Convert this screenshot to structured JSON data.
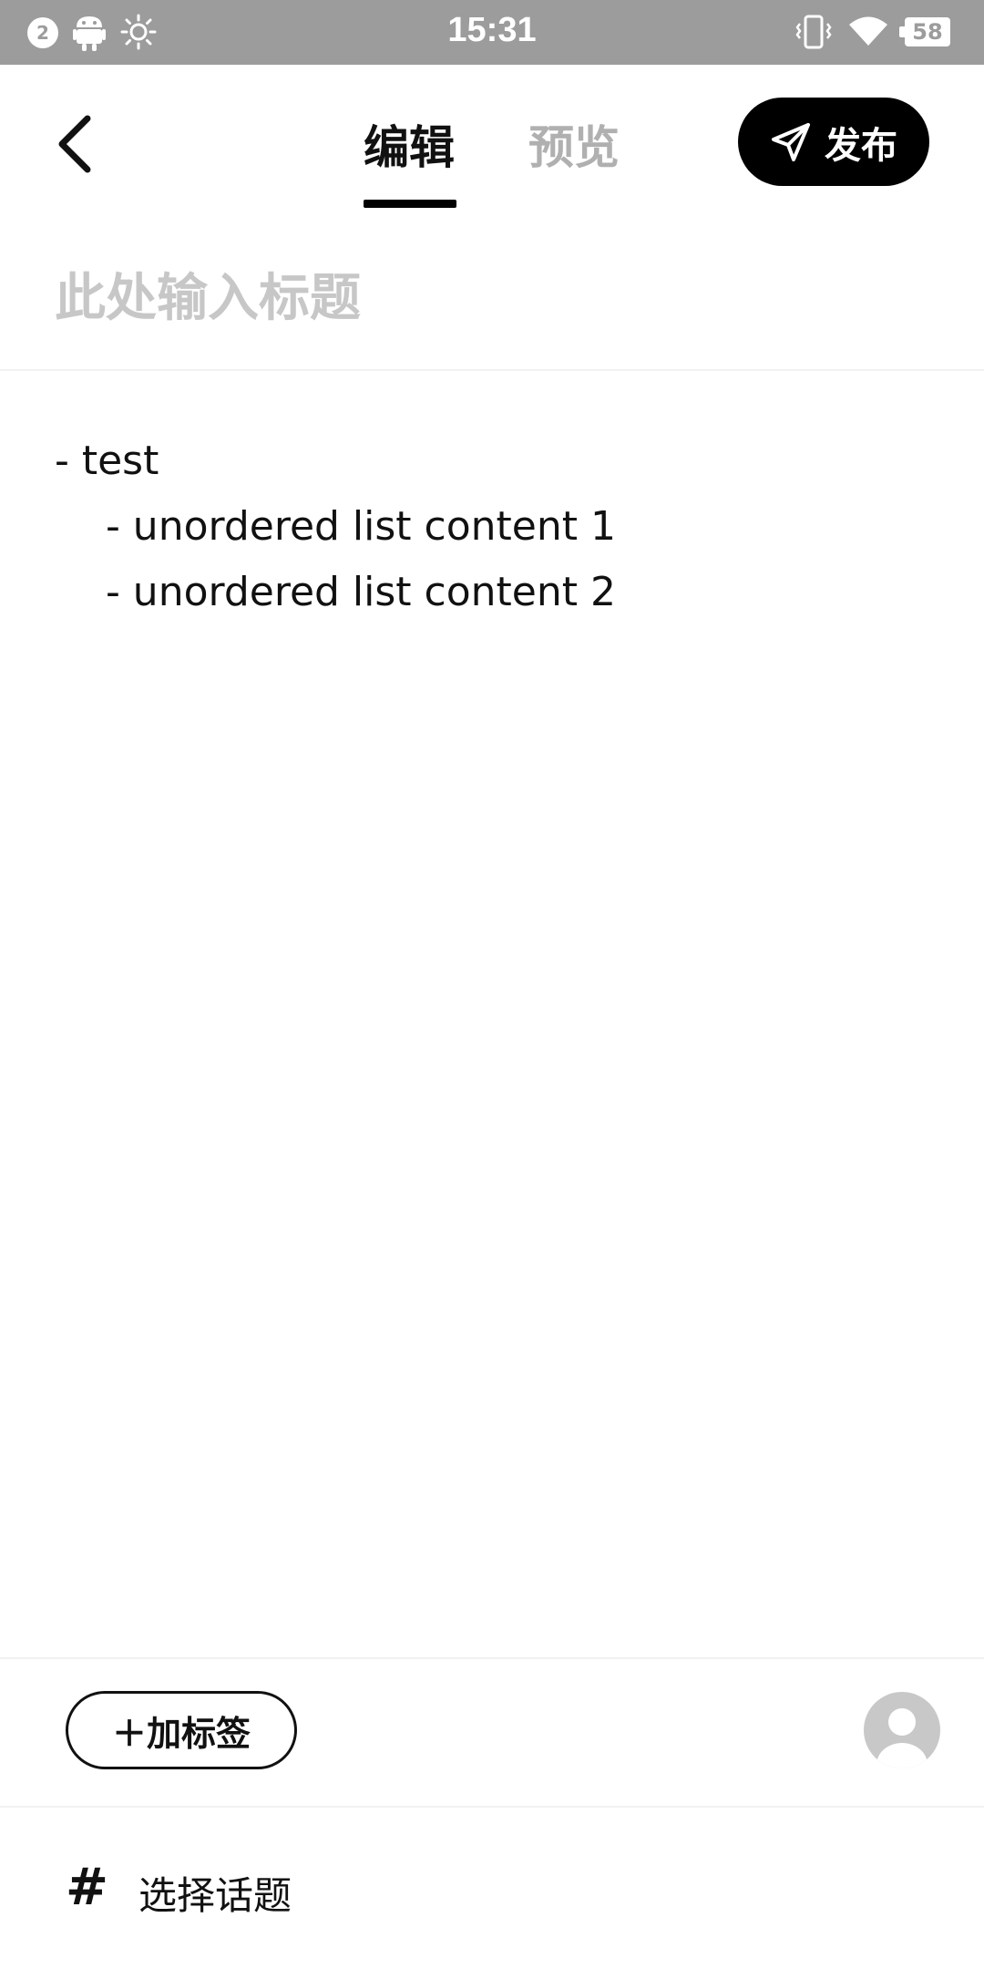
{
  "status_bar": {
    "notification_count": "2",
    "time": "15:31",
    "battery": "58",
    "icons": [
      "android-icon",
      "brightness-icon",
      "vibrate-icon",
      "wifi-icon",
      "battery-icon"
    ]
  },
  "header": {
    "tabs": [
      {
        "label": "编辑",
        "active": true
      },
      {
        "label": "预览",
        "active": false
      }
    ],
    "publish_label": "发布"
  },
  "editor": {
    "title_placeholder": "此处输入标题",
    "content_lines": [
      "- test",
      "    - unordered list content 1",
      "    - unordered list content 2"
    ]
  },
  "footer": {
    "add_tag_label": "＋加标签",
    "topic_label": "选择话题",
    "topic_icon": "#"
  },
  "colors": {
    "status_bar": "#9c9c9c",
    "accent": "#000000",
    "inactive_tab": "#b0b0b0",
    "placeholder": "#c7c7c7"
  }
}
